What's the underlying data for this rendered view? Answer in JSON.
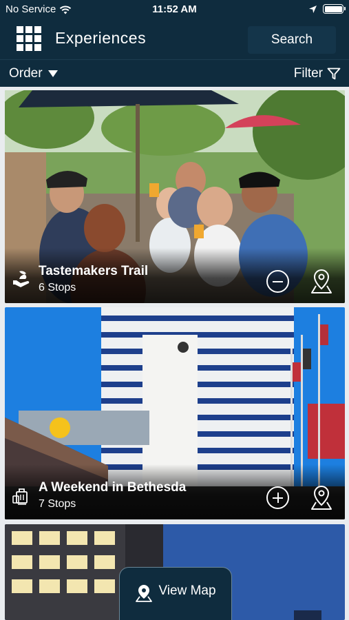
{
  "status_bar": {
    "carrier": "No Service",
    "time": "11:52 AM"
  },
  "header": {
    "title": "Experiences",
    "search_label": "Search",
    "order_label": "Order",
    "filter_label": "Filter"
  },
  "cards": [
    {
      "title": "Tastemakers Trail",
      "stops": "6 Stops",
      "action": "remove",
      "type_icon": "hand-plate-icon"
    },
    {
      "title": "A Weekend in Bethesda",
      "stops": "7 Stops",
      "action": "add",
      "type_icon": "luggage-icon"
    }
  ],
  "view_map_label": "View Map",
  "colors": {
    "nav_bg": "#0f2c3e",
    "search_bg": "#14354a",
    "text": "#ffffff"
  }
}
